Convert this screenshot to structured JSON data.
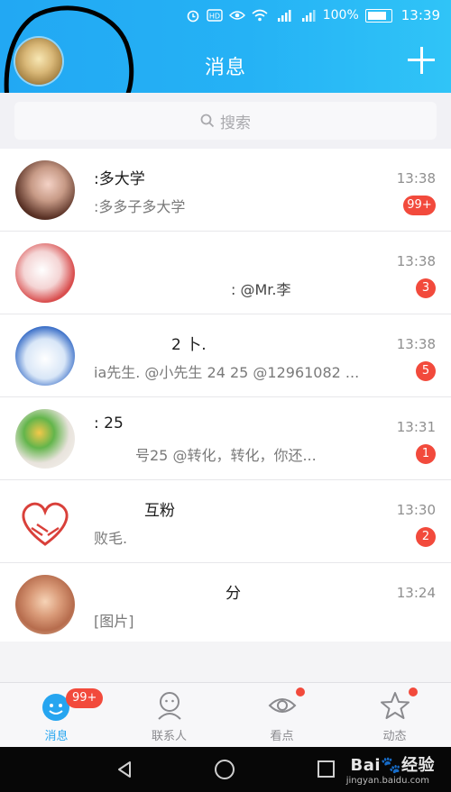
{
  "status_bar": {
    "battery": "100%",
    "time": "13:39",
    "signal_1": "4G",
    "signal_2": "2G"
  },
  "header": {
    "title": "消息"
  },
  "search": {
    "placeholder": "搜索"
  },
  "conversations": [
    {
      "name": ":多大学",
      "message": ":多多子多大学",
      "time": "13:38",
      "unread": "99+"
    },
    {
      "name": "",
      "message": ": @Mr.李",
      "time": "13:38",
      "unread": "3"
    },
    {
      "name": "2 卜.",
      "message": "ia先生. @小先生 24 25 @12961082 ...",
      "time": "13:38",
      "unread": "5"
    },
    {
      "name": ": 25",
      "message": "号25 @转化，转化，你还...",
      "time": "13:31",
      "unread": "1"
    },
    {
      "name": "互粉",
      "message": "败毛.",
      "time": "13:30",
      "unread": "2"
    },
    {
      "name": "分",
      "message": "[图片]",
      "time": "13:24",
      "unread": ""
    }
  ],
  "tabs": [
    {
      "label": "消息",
      "badge": "99+"
    },
    {
      "label": "联系人"
    },
    {
      "label": "看点"
    },
    {
      "label": "动态"
    }
  ],
  "watermark": {
    "brand": "Bai",
    "brand2": "经验",
    "url": "jingyan.baidu.com"
  },
  "colors": {
    "header_blue": "#22a8f3",
    "badge_red": "#f24a3c",
    "active_tab": "#26a5f0"
  }
}
